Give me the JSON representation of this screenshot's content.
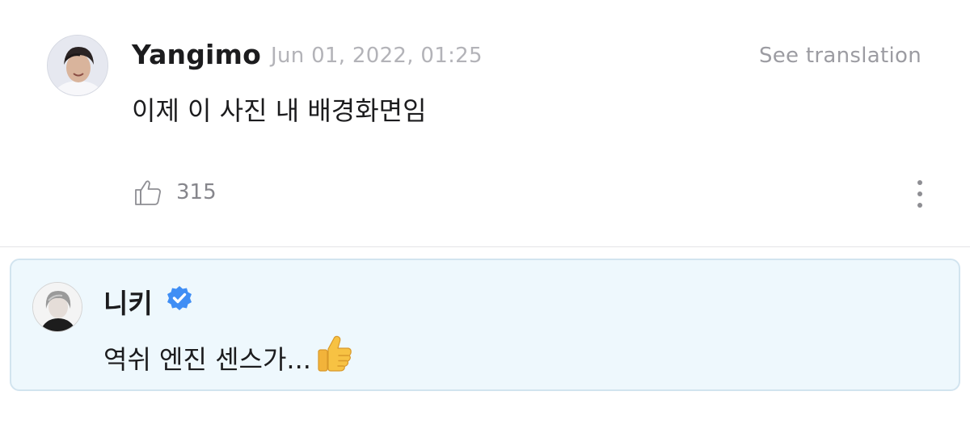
{
  "comment": {
    "author": "Yangimo",
    "timestamp": "Jun 01, 2022, 01:25",
    "translate_label": "See translation",
    "text": "이제 이 사진 내 배경화면임",
    "like_count": "315",
    "like_icon": "thumbs-up-outline-icon",
    "more_icon": "vertical-ellipsis-icon"
  },
  "reply": {
    "author": "니키",
    "verified_icon": "verified-badge-icon",
    "verified_color": "#3f8ef5",
    "text": "역쉬 엔진 센스가...",
    "emoji": "thumbs-up-emoji"
  },
  "colors": {
    "reply_background": "#eef8fd",
    "reply_border": "#d2e4ef"
  }
}
